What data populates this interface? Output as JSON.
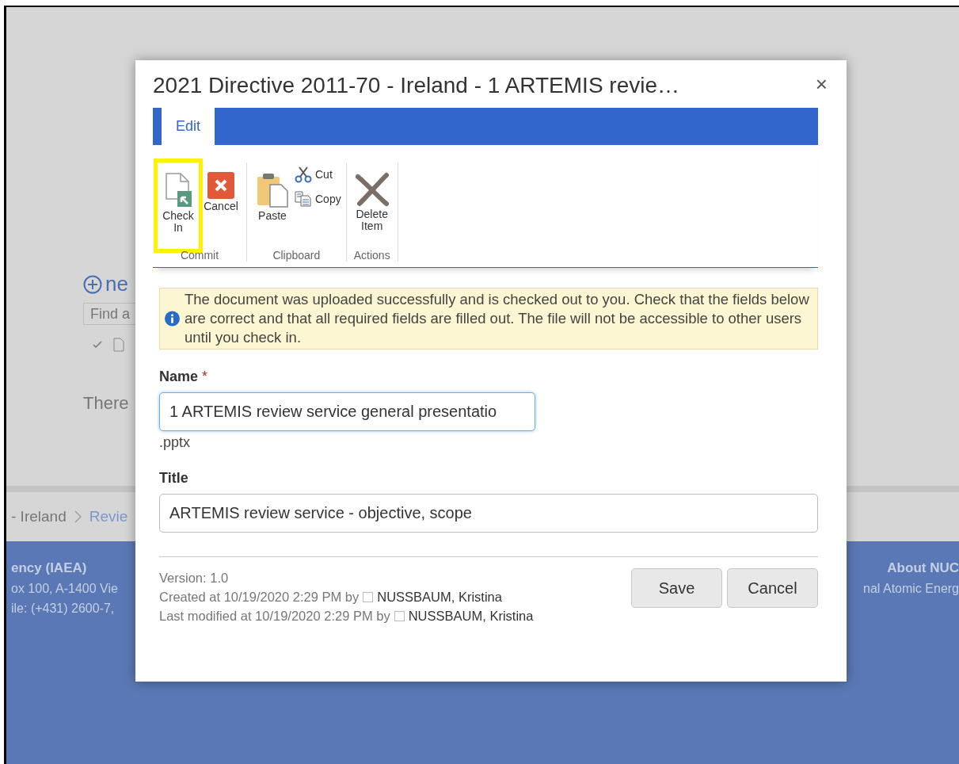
{
  "background": {
    "new_link": "ne",
    "search": {
      "placeholder": "Find a"
    },
    "empty_text": "There",
    "breadcrumb": [
      "- Ireland",
      "Revie"
    ],
    "footer": {
      "left": [
        "ency (IAEA)",
        "ox 100, A-1400 Vie",
        "ile: (+431) 2600-7,"
      ],
      "right": [
        "About NUC",
        "nal Atomic Energ"
      ]
    }
  },
  "dialog": {
    "title": "2021 Directive 2011-70 - Ireland - 1 ARTEMIS revie…",
    "close": "×",
    "tabs": [
      {
        "label": "Edit",
        "selected": true
      }
    ],
    "ribbon": [
      {
        "label": "Commit",
        "buttons": [
          {
            "kind": "check-in",
            "label": "Check In",
            "highlighted": true
          },
          {
            "kind": "cancel",
            "label": "Cancel",
            "highlighted": false
          }
        ]
      },
      {
        "label": "Clipboard",
        "buttons": [
          {
            "kind": "paste",
            "label": "Paste",
            "highlighted": false
          },
          {
            "kind": "cut",
            "label": "Cut",
            "highlighted": false
          },
          {
            "kind": "copy",
            "label": "Copy",
            "highlighted": false
          }
        ]
      },
      {
        "label": "Actions",
        "buttons": [
          {
            "kind": "delete",
            "label": "Delete Item",
            "highlighted": false
          }
        ]
      }
    ],
    "message": "The document was uploaded successfully and is checked out to you. Check that the fields below are correct and that all required fields are filled out. The file will not be accessible to other users until you check in.",
    "fields": [
      {
        "label": "Name",
        "required_mark": "*",
        "value": "1 ARTEMIS review service general presentatio",
        "focused": true,
        "suffix": ".pptx"
      },
      {
        "label": "Title",
        "value": "ARTEMIS review service - objective, scope",
        "focused": false
      }
    ],
    "version": "Version: 1.0",
    "created": {
      "text": "Created at 10/19/2020 2:29 PM  by",
      "user": "NUSSBAUM, Kristina"
    },
    "modified": {
      "text": "Last modified at 10/19/2020 2:29 PM  by",
      "user": "NUSSBAUM, Kristina"
    },
    "buttons": [
      "Save",
      "Cancel"
    ]
  }
}
